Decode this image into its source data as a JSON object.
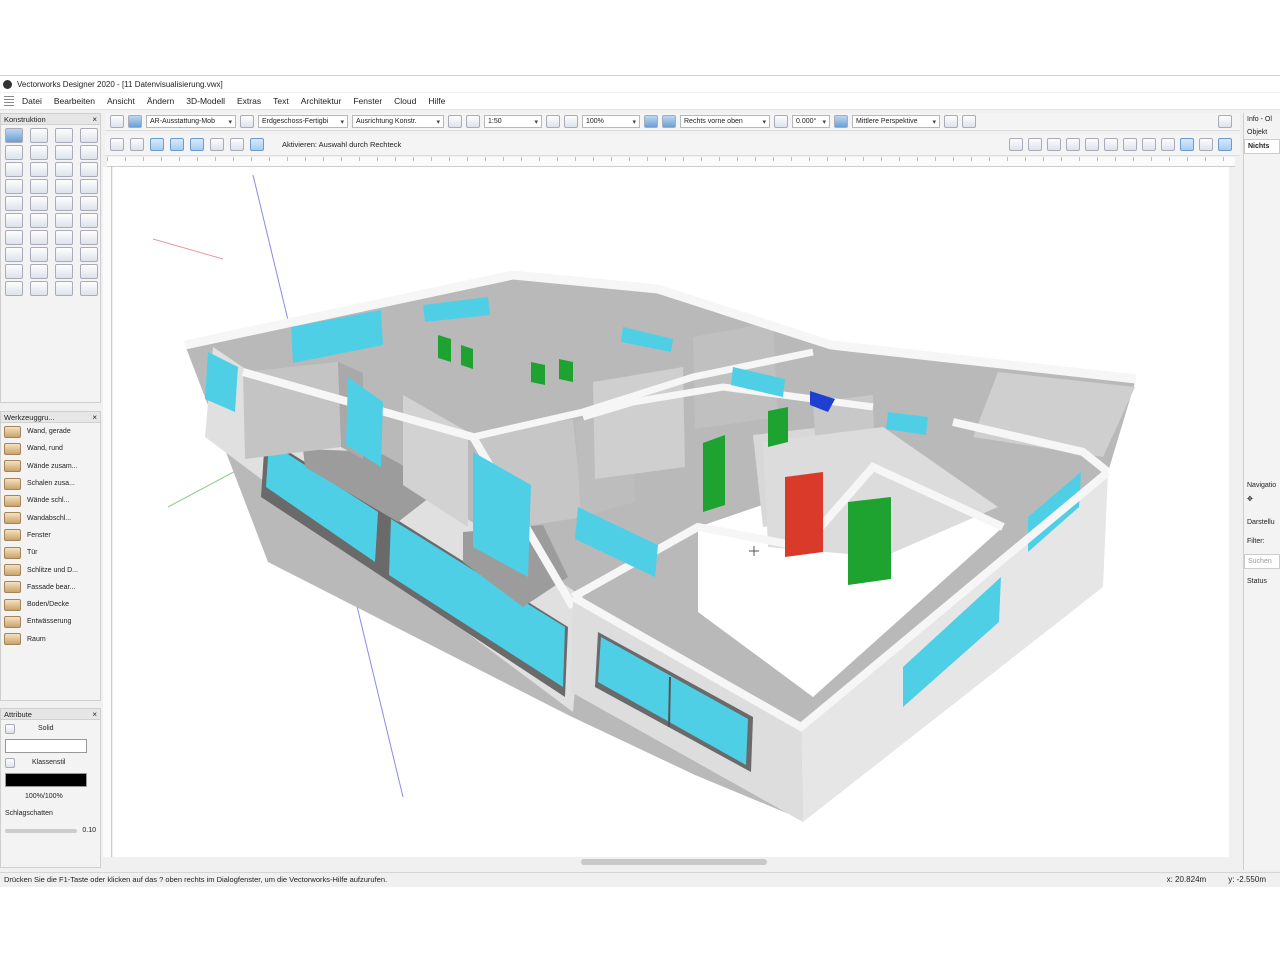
{
  "window": {
    "title": "Vectorworks Designer 2020 - [11 Datenvisualisierung.vwx]"
  },
  "menu": [
    "Datei",
    "Bearbeiten",
    "Ansicht",
    "Ändern",
    "3D-Modell",
    "Extras",
    "Text",
    "Architektur",
    "Fenster",
    "Cloud",
    "Hilfe"
  ],
  "view_bar": {
    "class": "AR-Ausstattung-Mob",
    "layer": "Erdgeschoss-Fertigbi",
    "alignment": "Ausrichtung Konstr.",
    "scale": "1:50",
    "zoom": "100%",
    "view": "Rechts vorne oben",
    "angle": "0.000°",
    "projection": "Mittlere Perspektive"
  },
  "mode_bar": {
    "hint": "Aktivieren: Auswahl durch Rechteck"
  },
  "palettes": {
    "konstruktion": {
      "title": "Konstruktion"
    },
    "werkzeuggruppen": {
      "title": "Werkzeuggru...",
      "items": [
        "Wand, gerade",
        "Wand, rund",
        "Wände zusam...",
        "Schalen zusa...",
        "Wände schl...",
        "Wandabschl...",
        "Fenster",
        "Tür",
        "Schlitze und D...",
        "Fassade bear...",
        "Boden/Decke",
        "Entwässerung",
        "Raum"
      ]
    },
    "attribute": {
      "title": "Attribute",
      "fill": "Solid",
      "pen": "Klassenstil",
      "opacity": "100%/100%",
      "shadow": "Schlagschatten",
      "shadow_value": "0.10"
    }
  },
  "info_panel": {
    "title": "Info - Ol",
    "tab_object": "Objekt",
    "tab_none": "Nichts"
  },
  "navigator_panel": {
    "title": "Navigatio",
    "label_display": "Darstellu",
    "label_filter": "Filter:",
    "search_placeholder": "Suchen",
    "col_status": "Status"
  },
  "status_bar": {
    "help": "Drücken Sie die F1-Taste oder klicken auf das ? oben rechts im Dialogfenster, um die Vectorworks-Hilfe aufzurufen.",
    "x": "20.824m",
    "y": "-2.550m"
  },
  "colors": {
    "window_glass": "#4fcfe6",
    "door_green": "#1ea331",
    "door_red": "#d93a2a",
    "wall_top": "#f6f6f6",
    "wall_side": "#bdbdbd",
    "floor": "#9c9c9c"
  }
}
